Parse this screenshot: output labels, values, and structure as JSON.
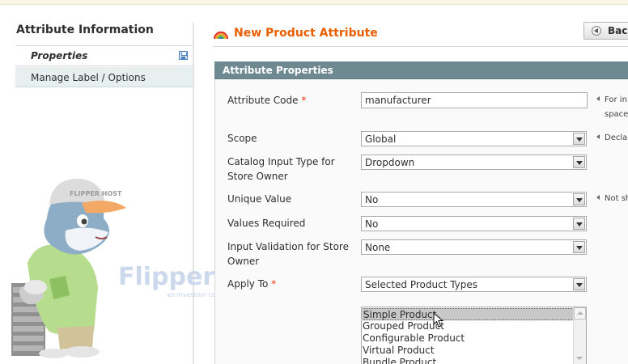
{
  "sidebar": {
    "title": "Attribute Information",
    "items": [
      {
        "label": "Properties",
        "active": true
      },
      {
        "label": "Manage Label / Options",
        "active": false
      }
    ]
  },
  "watermark": {
    "brand": "FlipperHost",
    "tagline": "an investion company",
    "cap_text": "FLIPPER HOST"
  },
  "header": {
    "title": "New Product Attribute",
    "back_label": "Back"
  },
  "fieldset": {
    "title": "Attribute Properties",
    "rows": {
      "attribute_code": {
        "label": "Attribute Code",
        "required": "*",
        "value": "manufacturer",
        "note_line1": "For in",
        "note_line2": "space"
      },
      "scope": {
        "label": "Scope",
        "value": "Global",
        "note": "Decla"
      },
      "catalog_input": {
        "label_line1": "Catalog Input Type for",
        "label_line2": "Store Owner",
        "value": "Dropdown"
      },
      "unique_value": {
        "label": "Unique Value",
        "value": "No",
        "note": "Not sh"
      },
      "values_required": {
        "label": "Values Required",
        "value": "No"
      },
      "input_validation": {
        "label_line1": "Input Validation for Store",
        "label_line2": "Owner",
        "value": "None"
      },
      "apply_to": {
        "label": "Apply To",
        "required": "*",
        "value": "Selected Product Types"
      }
    },
    "product_types": [
      {
        "label": "Simple Product",
        "selected": true
      },
      {
        "label": "Grouped Product",
        "selected": false
      },
      {
        "label": "Configurable Product",
        "selected": false
      },
      {
        "label": "Virtual Product",
        "selected": false
      },
      {
        "label": "Bundle Product",
        "selected": false
      }
    ]
  },
  "colors": {
    "title_orange": "#eb5e00",
    "fieldset_header": "#6f8992",
    "sidebar_item_bg": "#e7f0ef",
    "required_red": "#eb340a"
  }
}
